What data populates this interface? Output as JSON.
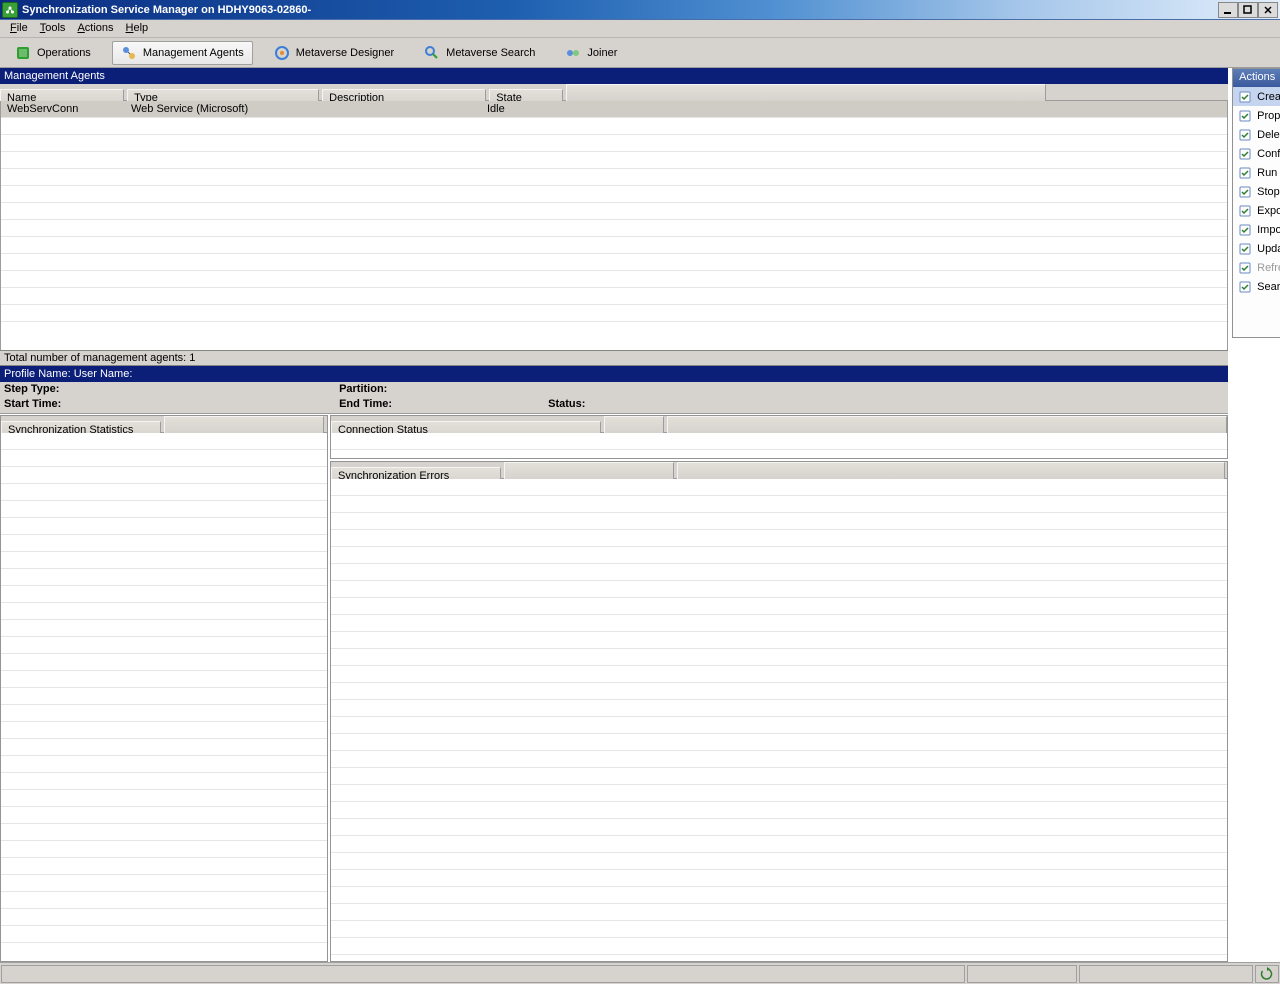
{
  "window": {
    "title": "Synchronization Service Manager on HDHY9063-02860-"
  },
  "menu": {
    "file": "File",
    "tools": "Tools",
    "actions": "Actions",
    "help": "Help"
  },
  "toolbar": {
    "operations": "Operations",
    "management_agents": "Management Agents",
    "metaverse_designer": "Metaverse Designer",
    "metaverse_search": "Metaverse Search",
    "joiner": "Joiner"
  },
  "ma_section": {
    "title": "Management Agents",
    "headers": {
      "name": "Name",
      "type": "Type",
      "description": "Description",
      "state": "State"
    },
    "rows": [
      {
        "name": "WebServConn",
        "type": "Web Service (Microsoft)",
        "description": "",
        "state": "Idle"
      }
    ],
    "total": "Total number of management agents: 1"
  },
  "profile": {
    "header": "Profile Name:   User Name:",
    "step_type_label": "Step Type:",
    "partition_label": "Partition:",
    "start_time_label": "Start Time:",
    "end_time_label": "End Time:",
    "status_label": "Status:"
  },
  "sync_stats": {
    "header": "Synchronization Statistics"
  },
  "conn_status": {
    "header": "Connection Status"
  },
  "sync_errors": {
    "header": "Synchronization Errors"
  },
  "actions": {
    "title": "Actions",
    "items": [
      {
        "label": "Create",
        "selected": true
      },
      {
        "label": "Properties"
      },
      {
        "label": "Delete"
      },
      {
        "label": "Configure Run Profiles"
      },
      {
        "label": "Run"
      },
      {
        "label": "Stop"
      },
      {
        "label": "Export Management Agent"
      },
      {
        "label": "Import Management Agent"
      },
      {
        "label": "Update Management Agent"
      },
      {
        "label": "Refresh Schema",
        "disabled": true
      },
      {
        "label": "Search Connector Space"
      }
    ]
  }
}
